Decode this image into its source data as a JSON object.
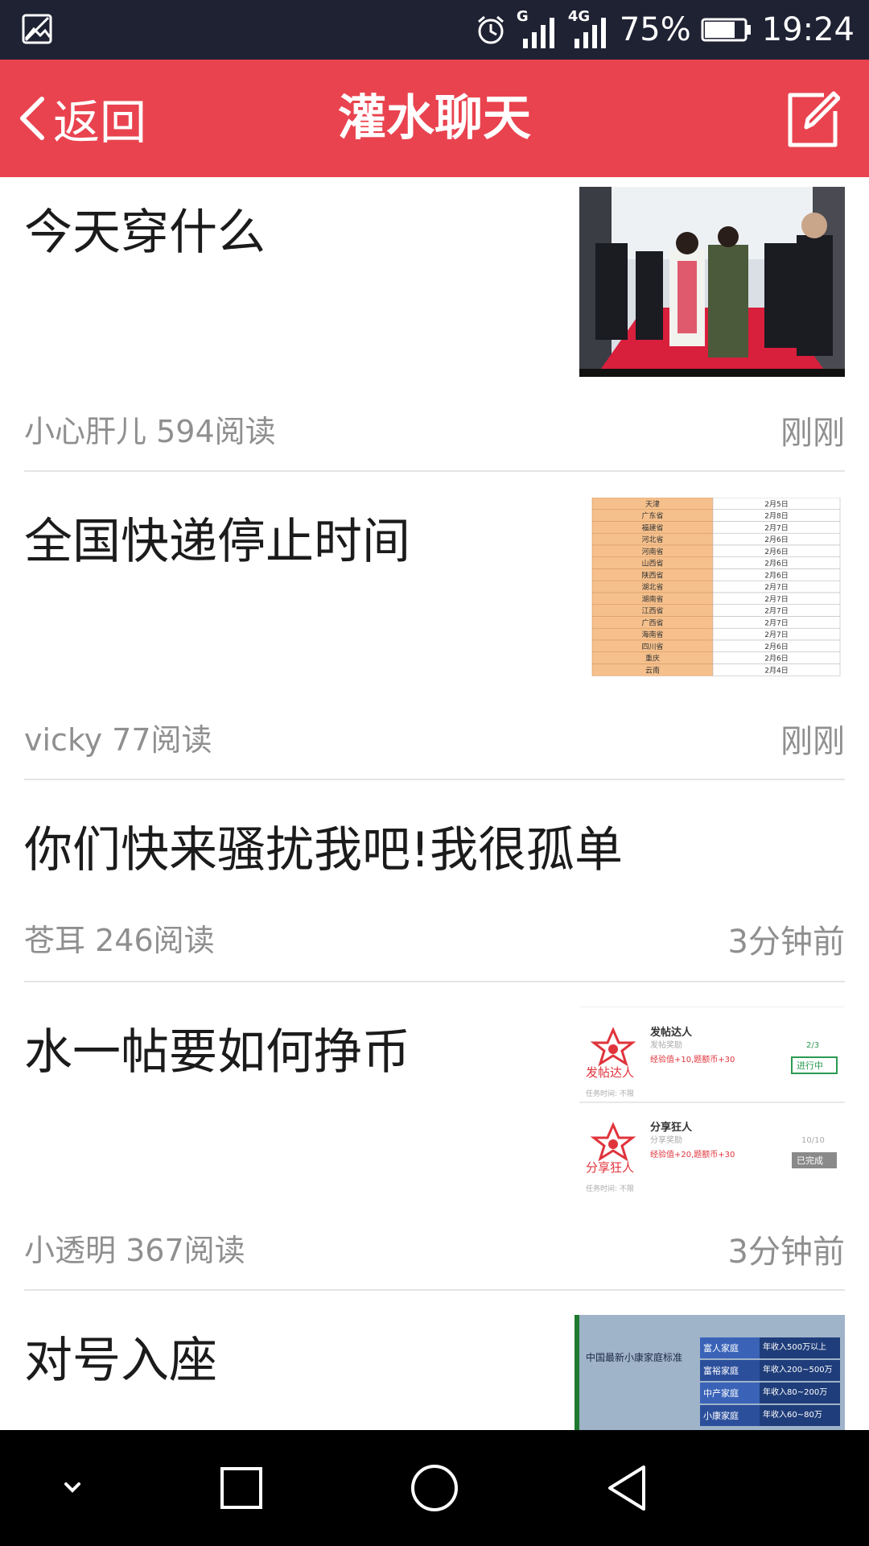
{
  "status_bar": {
    "network_label_1": "G",
    "network_label_2": "4G",
    "battery": "75%",
    "time": "19:24"
  },
  "header": {
    "back_label": "返回",
    "title": "灌水聊天"
  },
  "posts": [
    {
      "title": "今天穿什么",
      "author": "小心肝儿",
      "reads": "594阅读",
      "time": "刚刚"
    },
    {
      "title": "全国快递停止时间",
      "author": "vicky",
      "reads": "77阅读",
      "time": "刚刚"
    },
    {
      "title": "你们快来骚扰我吧!我很孤单",
      "author": "苍耳",
      "reads": "246阅读",
      "time": "3分钟前"
    },
    {
      "title": "水一帖要如何挣币",
      "author": "小透明",
      "reads": "367阅读",
      "time": "3分钟前"
    },
    {
      "title": "对号入座"
    }
  ],
  "thumb_texts": {
    "provinces": [
      "天津",
      "广东省",
      "福建省",
      "河北省",
      "河南省",
      "山西省",
      "陕西省",
      "湖北省",
      "湖南省",
      "江西省",
      "广西省",
      "海南省",
      "四川省",
      "重庆",
      "云南"
    ],
    "dates": [
      "2月5日",
      "2月8日",
      "2月7日",
      "2月6日",
      "2月6日",
      "2月6日",
      "2月6日",
      "2月7日",
      "2月7日",
      "2月7日",
      "2月7日",
      "2月7日",
      "2月6日",
      "2月6日",
      "2月4日"
    ],
    "task1_name": "发帖达人",
    "task1_sub": "发帖奖励",
    "task1_reward": "经验值+10,题额币+30",
    "task1_time": "任务时间: 不限",
    "task1_progress": "2/3",
    "task1_status": "进行中",
    "task1_badge": "发帖达人",
    "task2_name": "分享狂人",
    "task2_sub": "分享奖励",
    "task2_reward": "经验值+20,题额币+30",
    "task2_time": "任务时间: 不限",
    "task2_progress": "10/10",
    "task2_status": "已完成",
    "task2_badge": "分享狂人",
    "income_heading": "中国最新小康家庭标准",
    "income_rows": [
      {
        "label": "富人家庭",
        "value": "年收入500万以上"
      },
      {
        "label": "富裕家庭",
        "value": "年收入200~500万"
      },
      {
        "label": "中产家庭",
        "value": "年收入80~200万"
      },
      {
        "label": "小康家庭",
        "value": "年收入60~80万"
      }
    ]
  },
  "colors": {
    "status_bar": "#1f2233",
    "app_bar": "#e9434f",
    "title_text": "#1b1b1b",
    "meta_text": "#8f8f8f",
    "divider": "#e4e4e4",
    "nav_bar": "#000000"
  },
  "icons": {
    "status_left": "gallery-notification-icon",
    "alarm": "alarm-clock-icon",
    "back": "chevron-left-icon",
    "edit": "compose-icon",
    "nav_down": "chevron-down-icon",
    "nav_recent": "square-icon",
    "nav_home": "circle-icon",
    "nav_back": "triangle-back-icon"
  }
}
